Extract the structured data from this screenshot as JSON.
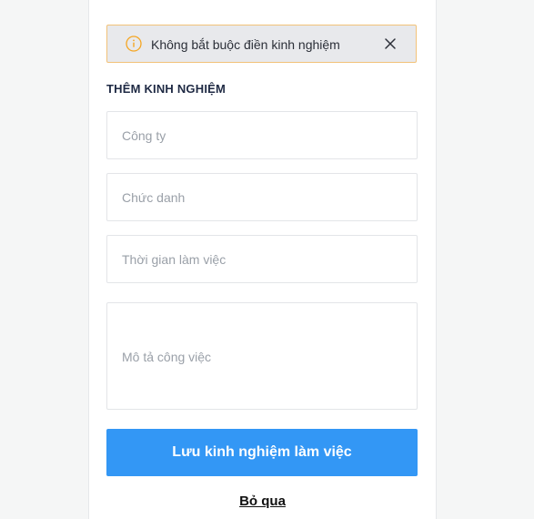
{
  "colors": {
    "page_bg": "#f5f6f6",
    "alert_bg": "#e8e9ec",
    "alert_border": "#f2c279",
    "alert_icon": "#f5a623",
    "title": "#1f2a44",
    "primary": "#3397f5",
    "placeholder": "#9aa0a8"
  },
  "alert": {
    "icon": "info-circle-icon",
    "text": "Không bắt buộc điền kinh nghiệm",
    "close_icon": "close-icon"
  },
  "section": {
    "title": "THÊM KINH NGHIỆM"
  },
  "form": {
    "company_placeholder": "Công ty",
    "position_placeholder": "Chức danh",
    "duration_placeholder": "Thời gian làm việc",
    "description_placeholder": "Mô tả công việc"
  },
  "actions": {
    "save_label": "Lưu kinh nghiệm làm việc",
    "skip_label": "Bỏ qua"
  }
}
